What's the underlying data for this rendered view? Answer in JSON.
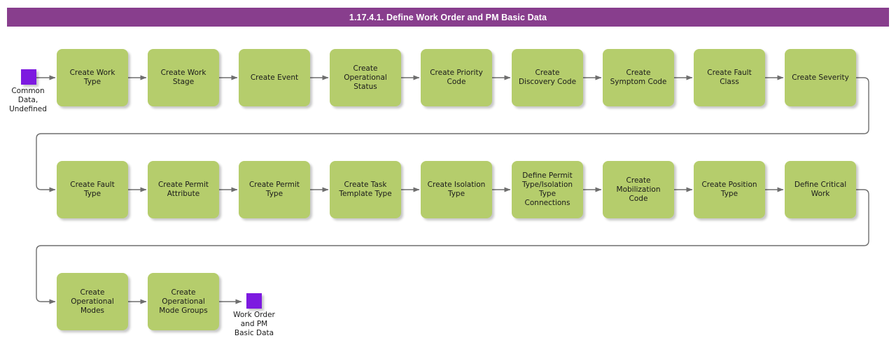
{
  "header": {
    "title": "1.17.4.1. Define Work Order and PM Basic Data",
    "bar_color": "#883e8d",
    "text_color": "#ffffff"
  },
  "theme": {
    "node_fill": "#b5cd6c",
    "terminator_fill": "#7d1ae0",
    "connector_color": "#666666",
    "canvas_background": "#ffffff",
    "label_color": "#1a1a1a"
  },
  "diagram": {
    "type": "flowchart",
    "orientation": "left-to-right, wrapping across 3 rows",
    "start_terminator": {
      "name": "common-data-undefined",
      "label": "Common\nData,\nUndefined"
    },
    "end_terminator": {
      "name": "work-order-and-pm-basic-data",
      "label": "Work Order\nand PM\nBasic Data"
    },
    "rows": [
      {
        "row_index": 1,
        "nodes": [
          {
            "id": "create-work-type",
            "label": "Create Work\nType"
          },
          {
            "id": "create-work-stage",
            "label": "Create Work\nStage"
          },
          {
            "id": "create-event",
            "label": "Create Event"
          },
          {
            "id": "create-operational-status",
            "label": "Create\nOperational\nStatus"
          },
          {
            "id": "create-priority-code",
            "label": "Create Priority\nCode"
          },
          {
            "id": "create-discovery-code",
            "label": "Create\nDiscovery Code"
          },
          {
            "id": "create-symptom-code",
            "label": "Create\nSymptom Code"
          },
          {
            "id": "create-fault-class",
            "label": "Create Fault\nClass"
          },
          {
            "id": "create-severity",
            "label": "Create Severity"
          }
        ]
      },
      {
        "row_index": 2,
        "nodes": [
          {
            "id": "create-fault-type",
            "label": "Create Fault\nType"
          },
          {
            "id": "create-permit-attribute",
            "label": "Create Permit\nAttribute"
          },
          {
            "id": "create-permit-type",
            "label": "Create Permit\nType"
          },
          {
            "id": "create-task-template-type",
            "label": "Create Task\nTemplate Type"
          },
          {
            "id": "create-isolation-type",
            "label": "Create Isolation\nType"
          },
          {
            "id": "define-permit-type-isolation-type-connections",
            "label": "Define Permit\nType/Isolation\nType\nConnections"
          },
          {
            "id": "create-mobilization-code",
            "label": "Create\nMobilization\nCode"
          },
          {
            "id": "create-position-type",
            "label": "Create Position\nType"
          },
          {
            "id": "define-critical-work",
            "label": "Define Critical\nWork"
          }
        ]
      },
      {
        "row_index": 3,
        "nodes": [
          {
            "id": "create-operational-modes",
            "label": "Create\nOperational\nModes"
          },
          {
            "id": "create-operational-mode-groups",
            "label": "Create\nOperational\nMode Groups"
          }
        ]
      }
    ],
    "flow_order": [
      "Common Data, Undefined",
      "Create Work Type",
      "Create Work Stage",
      "Create Event",
      "Create Operational Status",
      "Create Priority Code",
      "Create Discovery Code",
      "Create Symptom Code",
      "Create Fault Class",
      "Create Severity",
      "Create Fault Type",
      "Create Permit Attribute",
      "Create Permit Type",
      "Create Task Template Type",
      "Create Isolation Type",
      "Define Permit Type/Isolation Type Connections",
      "Create Mobilization Code",
      "Create Position Type",
      "Define Critical Work",
      "Create Operational Modes",
      "Create Operational Mode Groups",
      "Work Order and PM Basic Data"
    ]
  }
}
